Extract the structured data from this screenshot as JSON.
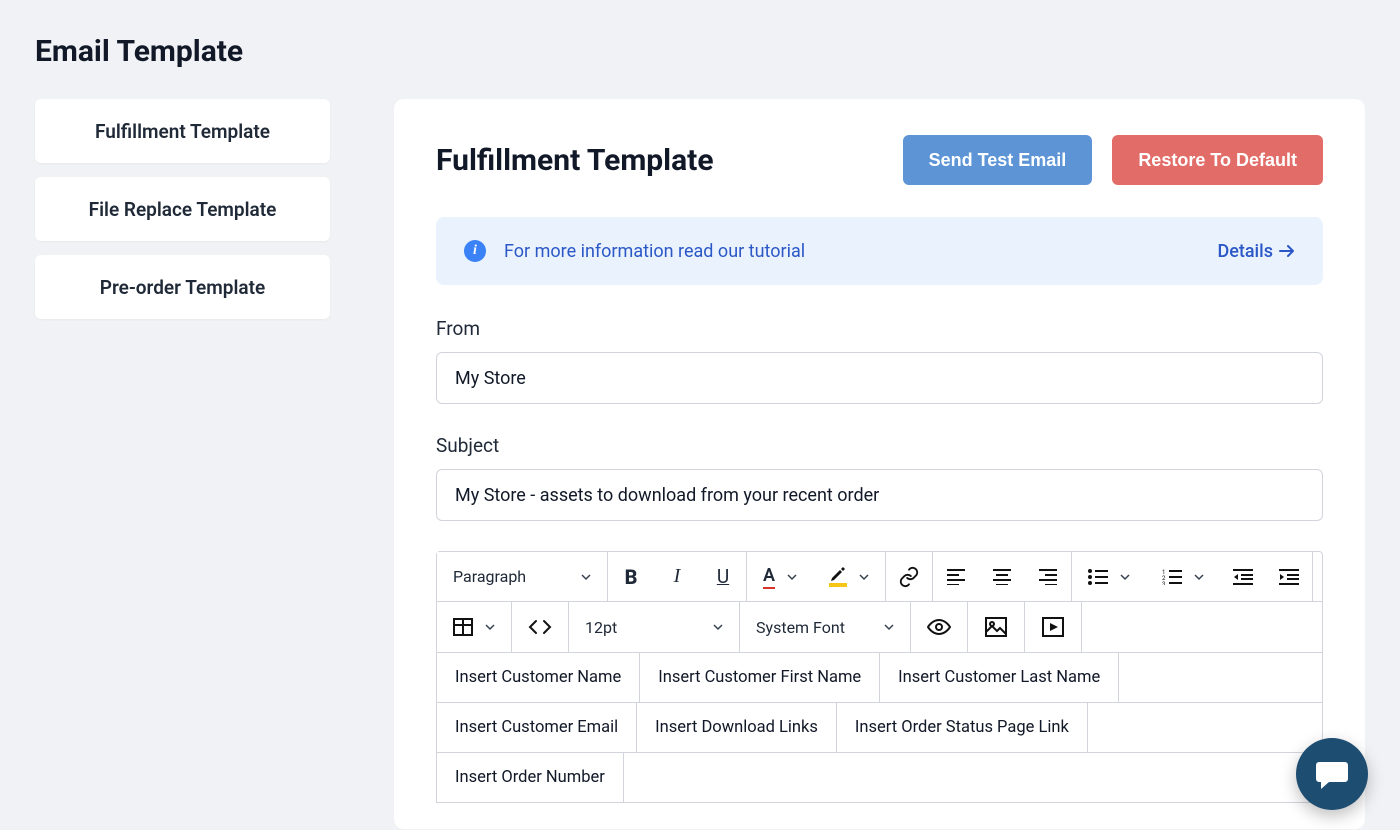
{
  "page": {
    "title": "Email Template"
  },
  "sidebar": {
    "items": [
      {
        "label": "Fulfillment Template"
      },
      {
        "label": "File Replace Template"
      },
      {
        "label": "Pre-order Template"
      }
    ]
  },
  "card": {
    "title": "Fulfillment Template",
    "send_test_label": "Send Test Email",
    "restore_label": "Restore To Default"
  },
  "banner": {
    "text": "For more information read our tutorial",
    "details_label": "Details"
  },
  "form": {
    "from_label": "From",
    "from_value": "My Store",
    "subject_label": "Subject",
    "subject_value": "My Store - assets to download from your recent order"
  },
  "toolbar": {
    "block_format": "Paragraph",
    "font_size": "12pt",
    "font_family": "System Font"
  },
  "merge_tags": [
    "Insert Customer Name",
    "Insert Customer First Name",
    "Insert Customer Last Name",
    "Insert Customer Email",
    "Insert Download Links",
    "Insert Order Status Page Link",
    "Insert Order Number"
  ],
  "colors": {
    "primary_blue": "#5c94d6",
    "danger_red": "#e26c67",
    "banner_bg": "#eaf2fd",
    "link_blue": "#2b58c6",
    "fab_bg": "#1e4d72"
  }
}
